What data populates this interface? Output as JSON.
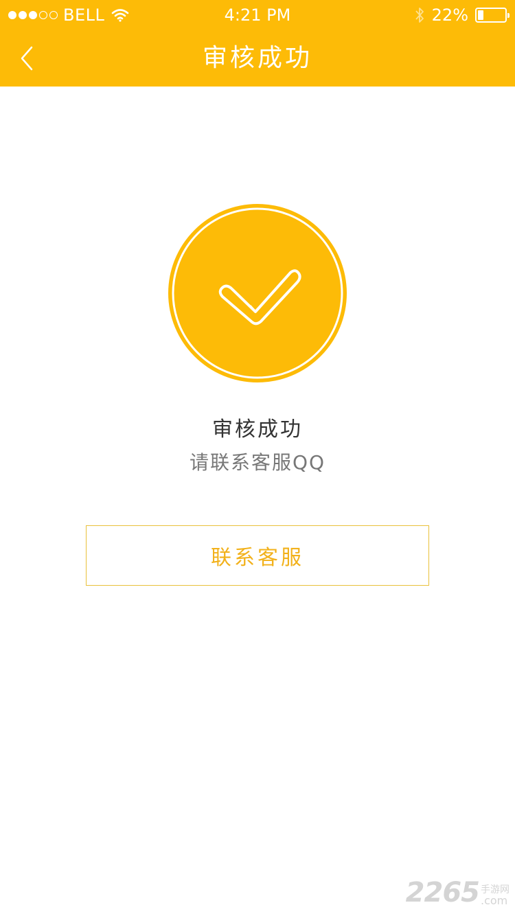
{
  "status_bar": {
    "carrier": "BELL",
    "time": "4:21 PM",
    "battery_percent": "22%",
    "battery_level": 0.22,
    "signal_bars_filled": 3,
    "signal_bars_total": 5
  },
  "nav": {
    "title": "审核成功",
    "back_icon": "chevron-left-icon"
  },
  "result": {
    "icon": "check-circle-icon",
    "title": "审核成功",
    "subtitle": "请联系客服QQ"
  },
  "actions": {
    "contact_label": "联系客服"
  },
  "watermark": {
    "number": "2265",
    "cn": "手游网",
    "suffix": ".com"
  },
  "colors": {
    "accent": "#FDBB07",
    "button_text": "#F2B11A",
    "button_border": "#E9C13A"
  }
}
